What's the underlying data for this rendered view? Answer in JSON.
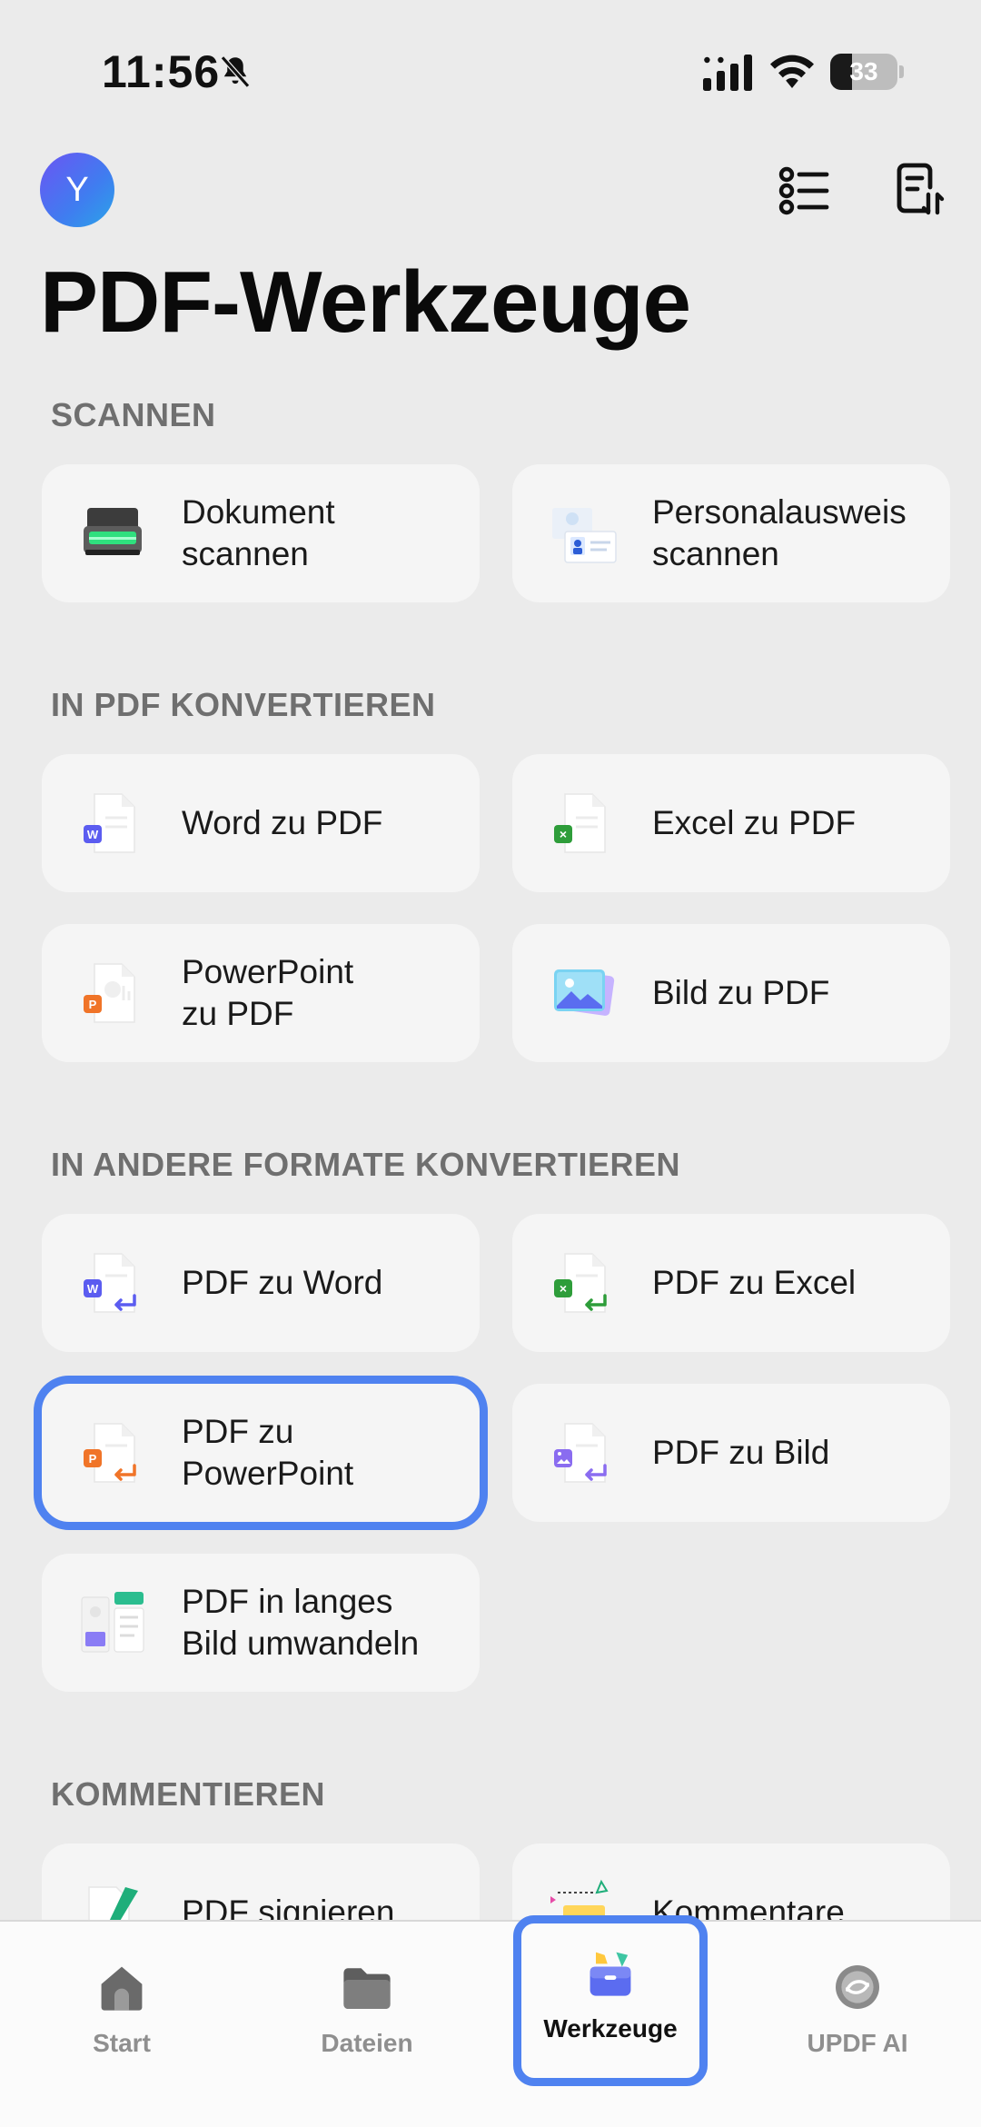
{
  "status": {
    "time": "11:56",
    "battery": "33",
    "battery_level": 0.33
  },
  "header": {
    "avatar_initial": "Y",
    "title": "PDF-Werkzeuge"
  },
  "sections": {
    "scan": "SCANNEN",
    "to_pdf": "IN PDF KONVERTIEREN",
    "from_pdf": "IN ANDERE FORMATE KONVERTIEREN",
    "comment": "KOMMENTIEREN"
  },
  "tools": {
    "scan_doc": "Dokument\nscannen",
    "scan_id": "Personalausweis\nscannen",
    "word_to_pdf": "Word zu PDF",
    "excel_to_pdf": "Excel zu PDF",
    "ppt_to_pdf": "PowerPoint\nzu PDF",
    "image_to_pdf": "Bild zu PDF",
    "pdf_to_word": "PDF zu Word",
    "pdf_to_excel": "PDF zu Excel",
    "pdf_to_ppt": "PDF zu\nPowerPoint",
    "pdf_to_image": "PDF zu Bild",
    "pdf_long_image": "PDF in langes\nBild umwandeln",
    "pdf_sign": "PDF signieren",
    "comments": "Kommentare"
  },
  "tabbar": {
    "start": "Start",
    "files": "Dateien",
    "tools": "Werkzeuge",
    "ai": "UPDF AI"
  },
  "colors": {
    "accent": "#4f82f0",
    "word": "#5b5cf0",
    "excel": "#2e9d3a",
    "powerpoint": "#f07428",
    "image": "#8a6cf0"
  }
}
